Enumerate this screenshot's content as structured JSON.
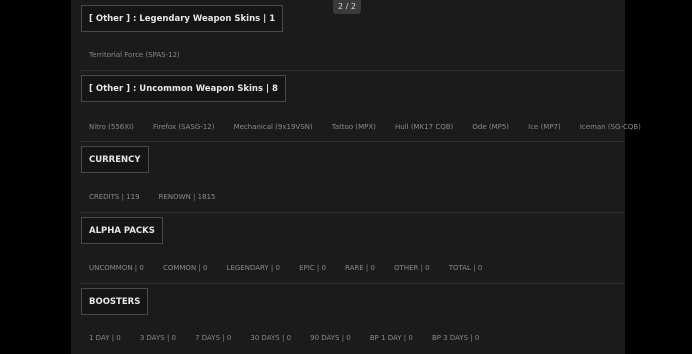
{
  "page_indicator": "2 / 2",
  "sections": [
    {
      "header": "[ Other ] : Legendary Weapon Skins | 1",
      "items": [
        "Territorial Force (SPAS-12)"
      ]
    },
    {
      "header": "[ Other ] : Uncommon Weapon Skins | 8",
      "items": [
        "Nitro (556XI)",
        "Firefox (SASG-12)",
        "Mechanical (9x19VSN)",
        "Tattoo (MPX)",
        "Hull (MK17 CQB)",
        "Ode (MP5)",
        "Ice (MP7)",
        "Iceman (SG-CQB)"
      ]
    },
    {
      "header": "CURRENCY",
      "items": [
        "CREDITS | 119",
        "RENOWN | 1815"
      ]
    },
    {
      "header": "ALPHA PACKS",
      "items": [
        "UNCOMMON | 0",
        "COMMON | 0",
        "LEGENDARY | 0",
        "EPIC | 0",
        "RARE | 0",
        "OTHER | 0",
        "TOTAL | 0"
      ]
    },
    {
      "header": "BOOSTERS",
      "items": [
        "1 DAY | 0",
        "3 DAYS | 0",
        "7 DAYS | 0",
        "30 DAYS | 0",
        "90 DAYS | 0",
        "BP 1 DAY | 0",
        "BP 3 DAYS | 0"
      ]
    }
  ]
}
